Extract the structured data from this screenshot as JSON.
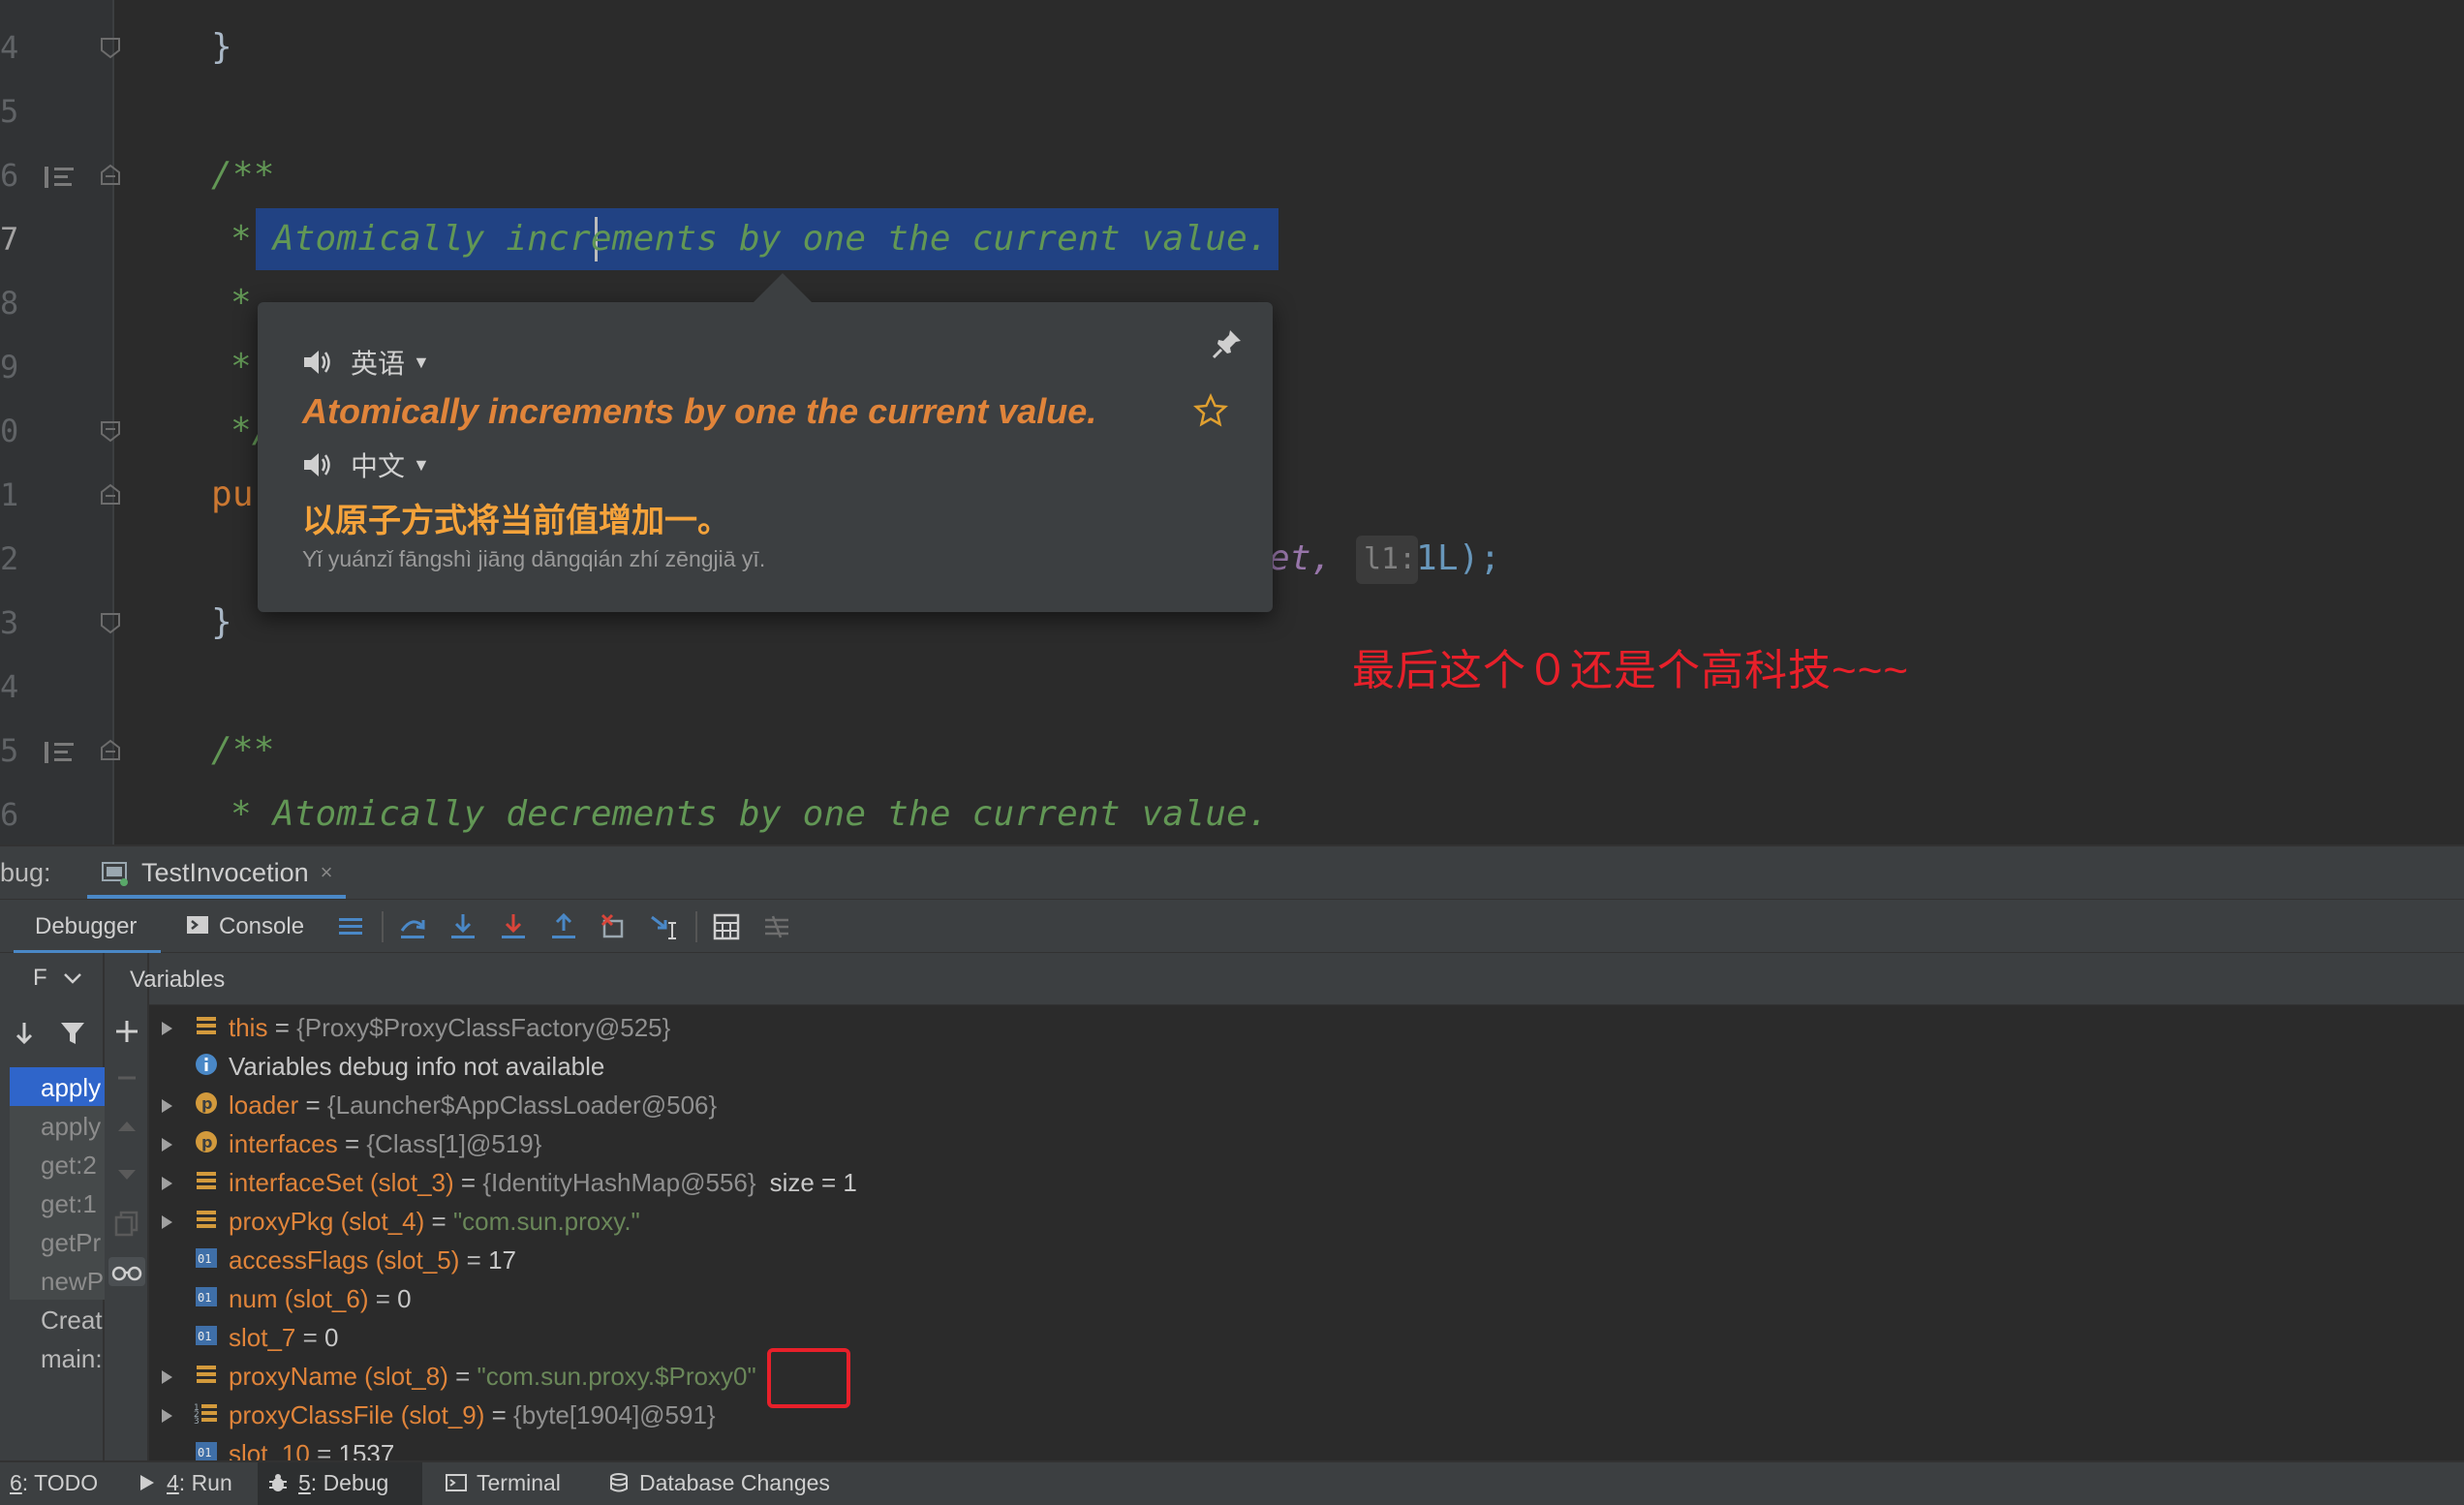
{
  "editor": {
    "lines": [
      {
        "no": "4",
        "text": "}"
      },
      {
        "no": "5",
        "text": ""
      },
      {
        "no": "6",
        "text": "/**"
      },
      {
        "no": "7",
        "text": "* Atomically increments by one the current value."
      },
      {
        "no": "8",
        "text": "*"
      },
      {
        "no": "9",
        "text": "*"
      },
      {
        "no": "0",
        "text": "*/"
      },
      {
        "no": "1",
        "text": "pu"
      },
      {
        "no": "2",
        "text": "et,"
      },
      {
        "no": "3",
        "text": "}"
      },
      {
        "no": "4",
        "text": ""
      },
      {
        "no": "5",
        "text": "/**"
      },
      {
        "no": "6",
        "text": "* Atomically decrements by one the current value."
      }
    ],
    "inlay_hint": "l1:",
    "inlay_value": "1L);"
  },
  "translate_popup": {
    "source_lang": "英语",
    "source_text": "Atomically increments by one the current value.",
    "target_lang": "中文",
    "translated_text": "以原子方式将当前值增加一。",
    "pinyin": "Yǐ yuánzǐ fāngshì jiāng dāngqián zhí zēngjiā yī."
  },
  "annotation": "最后这个０还是个高科技~~~",
  "debug": {
    "label": "bug:",
    "session_tab": "TestInvocetion",
    "close": "×",
    "tabs": [
      "Debugger",
      "Console"
    ],
    "frames_dropdown": "F",
    "variables_title": "Variables",
    "frames": [
      "apply",
      "apply",
      "get:2",
      "get:1",
      "getPr",
      "newP",
      "Creat",
      "main:"
    ],
    "variables": [
      {
        "name": "this",
        "eq": " = ",
        "value": "{Proxy$ProxyClassFactory@525}",
        "kind": "ref",
        "icon": "field-icon",
        "expandable": true
      },
      {
        "name": "",
        "eq": "",
        "value": "Variables debug info not available",
        "kind": "plain",
        "icon": "info-icon",
        "expandable": false
      },
      {
        "name": "loader",
        "eq": " = ",
        "value": "{Launcher$AppClassLoader@506}",
        "kind": "ref",
        "icon": "param-icon",
        "expandable": true
      },
      {
        "name": "interfaces",
        "eq": " = ",
        "value": "{Class[1]@519}",
        "kind": "ref",
        "icon": "param-icon",
        "expandable": true
      },
      {
        "name": "interfaceSet (slot_3)",
        "eq": " = ",
        "value": "{IdentityHashMap@556}",
        "kind": "ref",
        "icon": "field-icon",
        "expandable": true,
        "extra": "size = 1"
      },
      {
        "name": "proxyPkg (slot_4)",
        "eq": " = ",
        "value": "\"com.sun.proxy.\"",
        "kind": "str",
        "icon": "field-icon",
        "expandable": true
      },
      {
        "name": "accessFlags (slot_5)",
        "eq": " = ",
        "value": "17",
        "kind": "num",
        "icon": "primitive-icon",
        "expandable": false
      },
      {
        "name": "num (slot_6)",
        "eq": " = ",
        "value": "0",
        "kind": "num",
        "icon": "primitive-icon",
        "expandable": false
      },
      {
        "name": "slot_7",
        "eq": " = ",
        "value": "0",
        "kind": "num",
        "icon": "primitive-icon",
        "expandable": false
      },
      {
        "name": "proxyName (slot_8)",
        "eq": " = ",
        "value": "\"com.sun.proxy.$Proxy0\"",
        "kind": "str",
        "icon": "field-icon",
        "expandable": true
      },
      {
        "name": "proxyClassFile (slot_9)",
        "eq": " = ",
        "value": "{byte[1904]@591}",
        "kind": "ref",
        "icon": "array-icon",
        "expandable": true
      },
      {
        "name": "slot_10",
        "eq": " = ",
        "value": "1537",
        "kind": "num",
        "icon": "primitive-icon",
        "expandable": false
      }
    ]
  },
  "statusbar": [
    {
      "key": "6",
      "label": ": TODO"
    },
    {
      "key": "4",
      "label": ": Run"
    },
    {
      "key": "5",
      "label": ": Debug"
    },
    {
      "key": "",
      "label": "Terminal"
    },
    {
      "key": "",
      "label": "Database Changes"
    }
  ],
  "colors": {
    "selection": "#214283",
    "doc_comment": "#629755",
    "keyword": "#cc7832",
    "annotation_red": "#e8202a",
    "popup_source": "#e0843a",
    "popup_translation": "#f5a33b",
    "accent_blue": "#4a88c7"
  }
}
